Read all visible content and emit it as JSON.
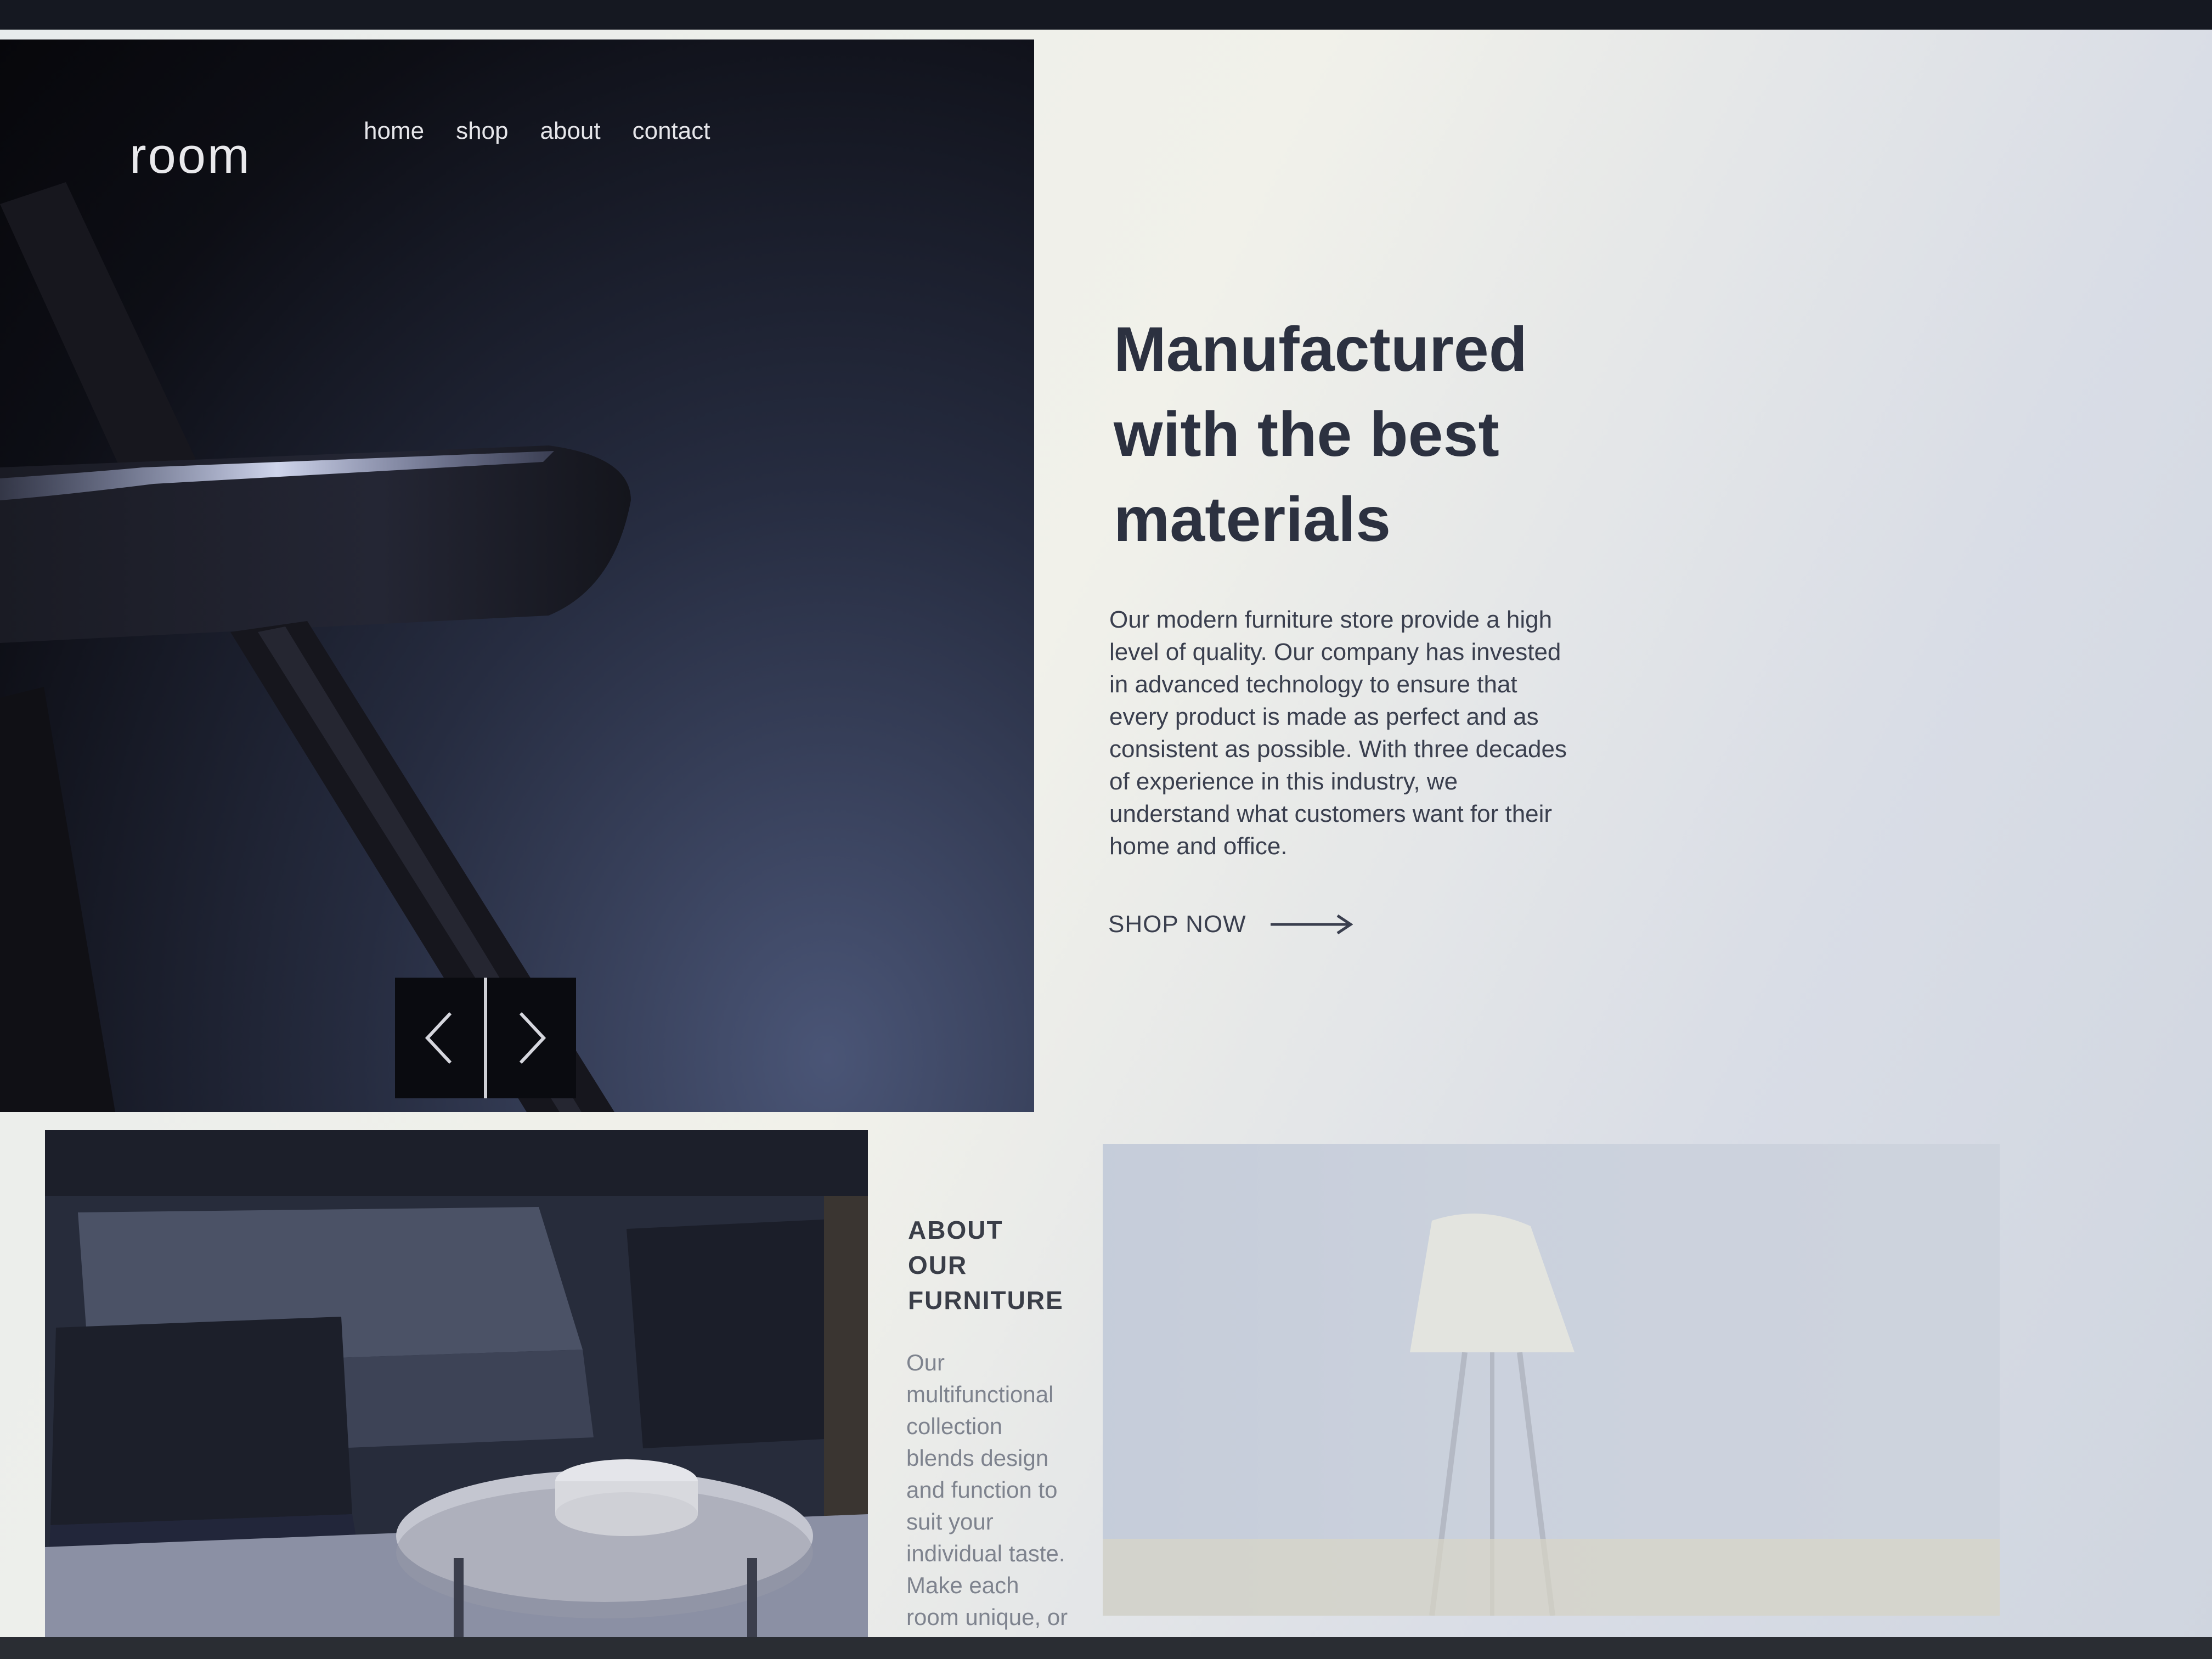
{
  "brand": {
    "logo": "room"
  },
  "nav": {
    "items": [
      {
        "label": "home"
      },
      {
        "label": "shop"
      },
      {
        "label": "about"
      },
      {
        "label": "contact"
      }
    ]
  },
  "slider": {
    "prev_icon": "chevron-left-icon",
    "next_icon": "chevron-right-icon"
  },
  "hero": {
    "title_lines": [
      "Manufactured",
      "with the best",
      "materials"
    ],
    "body": "Our modern furniture store provide a high level of quality. Our company has invested in advanced technology to ensure that every product is made as perfect and as consistent as possible. With three decades of experience in this industry, we understand what customers want for their home and office.",
    "cta_label": "SHOP NOW",
    "cta_icon": "arrow-right-icon"
  },
  "about": {
    "heading_lines": [
      "ABOUT",
      "OUR",
      "FURNITURE"
    ],
    "body": "Our multifunctional collection blends design and function to suit your individual taste. Make each room unique, or pick"
  },
  "colors": {
    "hero_dark": "#0d0e15",
    "heading_text": "#2c3140",
    "body_text": "#3a3f4e",
    "muted_text": "#7e838e",
    "page_background": "#f1f1ea"
  }
}
